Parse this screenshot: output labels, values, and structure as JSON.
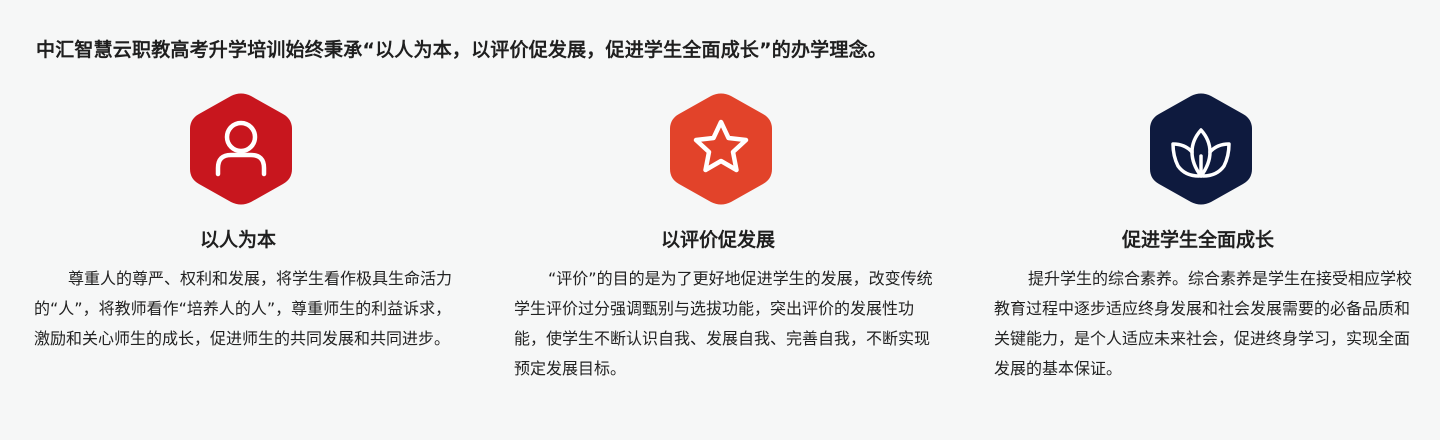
{
  "intro": "中汇智慧云职教高考升学培训始终秉承“以人为本，以评价促发展，促进学生全面成长”的办学理念。",
  "pillars": [
    {
      "icon": "user-icon",
      "color": "#c8161e",
      "title": "以人为本",
      "description": "尊重人的尊严、权利和发展，将学生看作极具生命活力的“人”，将教师看作“培养人的人”，尊重师生的利益诉求，激励和关心师生的成长，促进师生的共同发展和共同进步。"
    },
    {
      "icon": "star-icon",
      "color": "#e2432a",
      "title": "以评价促发展",
      "description": "“评价”的目的是为了更好地促进学生的发展，改变传统学生评价过分强调甄别与选拔功能，突出评价的发展性功能，使学生不断认识自我、发展自我、完善自我，不断实现预定发展目标。"
    },
    {
      "icon": "leaf-icon",
      "color": "#0e1a3e",
      "title": "促进学生全面成长",
      "description": "提升学生的综合素养。综合素养是学生在接受相应学校教育过程中逐步适应终身发展和社会发展需要的必备品质和关键能力，是个人适应未来社会，促进终身学习，实现全面发展的基本保证。"
    }
  ]
}
